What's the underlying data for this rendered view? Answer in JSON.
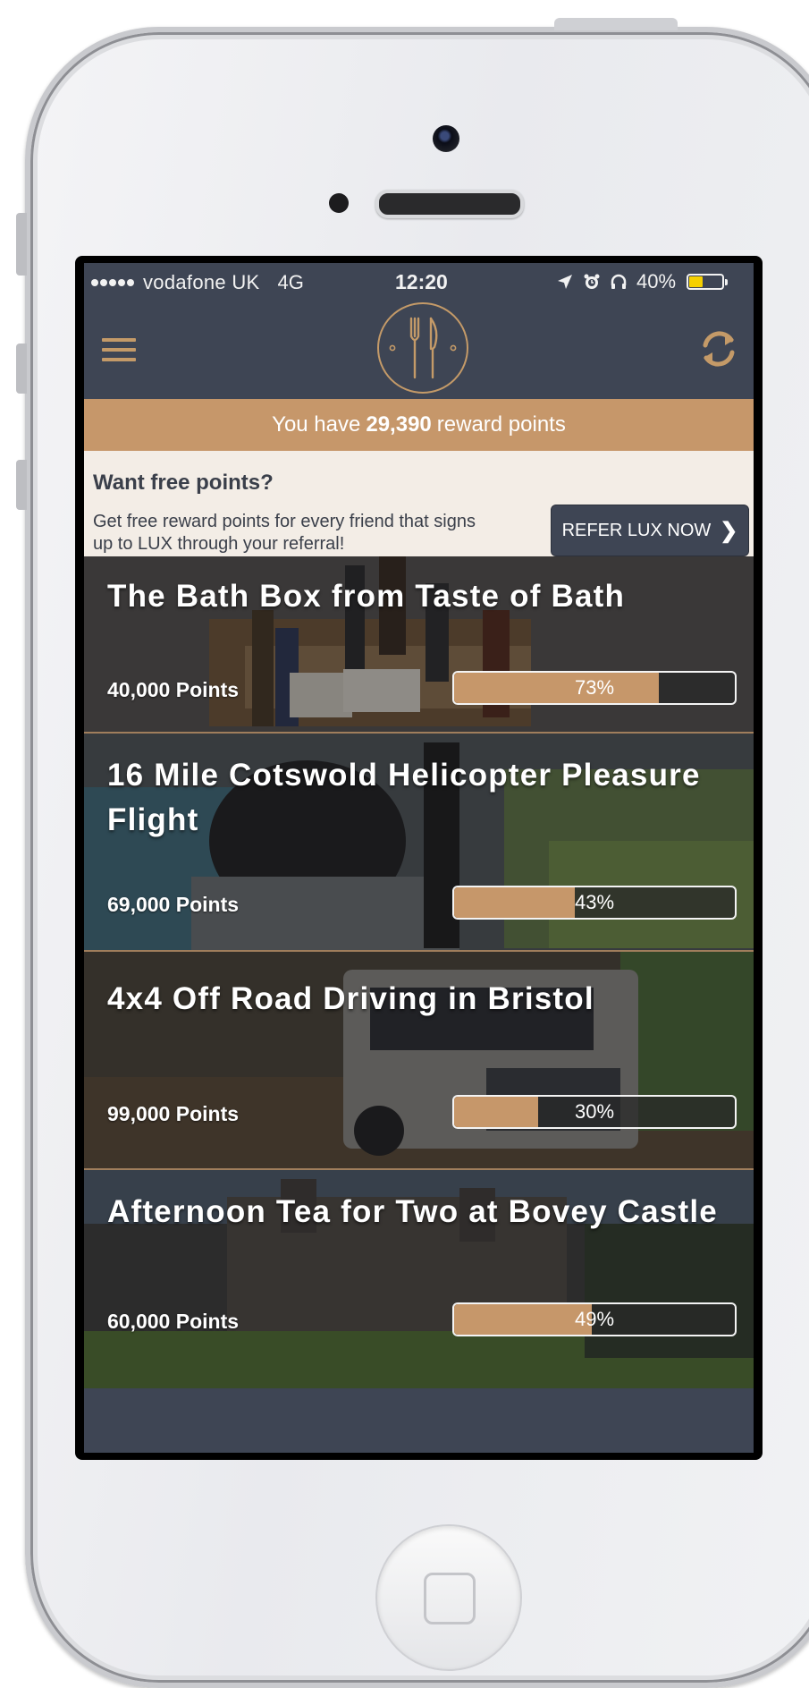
{
  "status_bar": {
    "carrier": "vodafone UK",
    "network": "4G",
    "time": "12:20",
    "battery": "40%",
    "battery_level": 0.4
  },
  "header": {
    "points_prefix": "You have",
    "points_value": "29,390",
    "points_suffix": "reward points"
  },
  "referral": {
    "title": "Want free points?",
    "text": "Get free reward points for every friend that signs up to LUX through your referral!",
    "button_label": "REFER LUX NOW",
    "button_icon": "chevron-right-icon"
  },
  "colors": {
    "nav": "#3e4554",
    "accent": "#c6976a",
    "referral_bg": "#f3ede6"
  },
  "rewards": [
    {
      "title": "The Bath Box from Taste of Bath",
      "points": "40,000 Points",
      "progress_label": "73%",
      "progress": 0.73
    },
    {
      "title": "16 Mile Cotswold Helicopter Pleasure Flight",
      "points": "69,000 Points",
      "progress_label": "43%",
      "progress": 0.43
    },
    {
      "title": "4x4 Off Road Driving in Bristol",
      "points": "99,000 Points",
      "progress_label": "30%",
      "progress": 0.3
    },
    {
      "title": "Afternoon Tea for Two at Bovey Castle",
      "points": "60,000 Points",
      "progress_label": "49%",
      "progress": 0.49
    }
  ]
}
